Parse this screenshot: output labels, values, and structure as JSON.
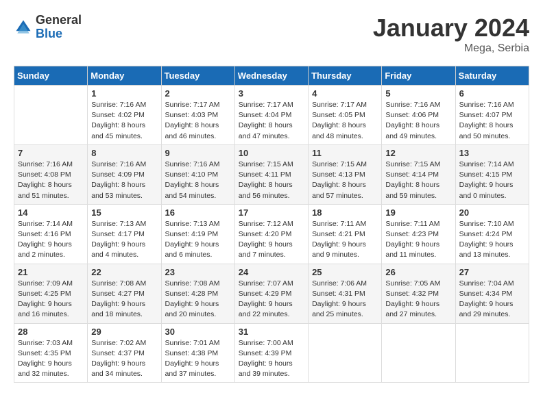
{
  "logo": {
    "general": "General",
    "blue": "Blue"
  },
  "title": "January 2024",
  "location": "Mega, Serbia",
  "days_of_week": [
    "Sunday",
    "Monday",
    "Tuesday",
    "Wednesday",
    "Thursday",
    "Friday",
    "Saturday"
  ],
  "weeks": [
    [
      {
        "day": "",
        "text": ""
      },
      {
        "day": "1",
        "text": "Sunrise: 7:16 AM\nSunset: 4:02 PM\nDaylight: 8 hours\nand 45 minutes."
      },
      {
        "day": "2",
        "text": "Sunrise: 7:17 AM\nSunset: 4:03 PM\nDaylight: 8 hours\nand 46 minutes."
      },
      {
        "day": "3",
        "text": "Sunrise: 7:17 AM\nSunset: 4:04 PM\nDaylight: 8 hours\nand 47 minutes."
      },
      {
        "day": "4",
        "text": "Sunrise: 7:17 AM\nSunset: 4:05 PM\nDaylight: 8 hours\nand 48 minutes."
      },
      {
        "day": "5",
        "text": "Sunrise: 7:16 AM\nSunset: 4:06 PM\nDaylight: 8 hours\nand 49 minutes."
      },
      {
        "day": "6",
        "text": "Sunrise: 7:16 AM\nSunset: 4:07 PM\nDaylight: 8 hours\nand 50 minutes."
      }
    ],
    [
      {
        "day": "7",
        "text": "Sunrise: 7:16 AM\nSunset: 4:08 PM\nDaylight: 8 hours\nand 51 minutes."
      },
      {
        "day": "8",
        "text": "Sunrise: 7:16 AM\nSunset: 4:09 PM\nDaylight: 8 hours\nand 53 minutes."
      },
      {
        "day": "9",
        "text": "Sunrise: 7:16 AM\nSunset: 4:10 PM\nDaylight: 8 hours\nand 54 minutes."
      },
      {
        "day": "10",
        "text": "Sunrise: 7:15 AM\nSunset: 4:11 PM\nDaylight: 8 hours\nand 56 minutes."
      },
      {
        "day": "11",
        "text": "Sunrise: 7:15 AM\nSunset: 4:13 PM\nDaylight: 8 hours\nand 57 minutes."
      },
      {
        "day": "12",
        "text": "Sunrise: 7:15 AM\nSunset: 4:14 PM\nDaylight: 8 hours\nand 59 minutes."
      },
      {
        "day": "13",
        "text": "Sunrise: 7:14 AM\nSunset: 4:15 PM\nDaylight: 9 hours\nand 0 minutes."
      }
    ],
    [
      {
        "day": "14",
        "text": "Sunrise: 7:14 AM\nSunset: 4:16 PM\nDaylight: 9 hours\nand 2 minutes."
      },
      {
        "day": "15",
        "text": "Sunrise: 7:13 AM\nSunset: 4:17 PM\nDaylight: 9 hours\nand 4 minutes."
      },
      {
        "day": "16",
        "text": "Sunrise: 7:13 AM\nSunset: 4:19 PM\nDaylight: 9 hours\nand 6 minutes."
      },
      {
        "day": "17",
        "text": "Sunrise: 7:12 AM\nSunset: 4:20 PM\nDaylight: 9 hours\nand 7 minutes."
      },
      {
        "day": "18",
        "text": "Sunrise: 7:11 AM\nSunset: 4:21 PM\nDaylight: 9 hours\nand 9 minutes."
      },
      {
        "day": "19",
        "text": "Sunrise: 7:11 AM\nSunset: 4:23 PM\nDaylight: 9 hours\nand 11 minutes."
      },
      {
        "day": "20",
        "text": "Sunrise: 7:10 AM\nSunset: 4:24 PM\nDaylight: 9 hours\nand 13 minutes."
      }
    ],
    [
      {
        "day": "21",
        "text": "Sunrise: 7:09 AM\nSunset: 4:25 PM\nDaylight: 9 hours\nand 16 minutes."
      },
      {
        "day": "22",
        "text": "Sunrise: 7:08 AM\nSunset: 4:27 PM\nDaylight: 9 hours\nand 18 minutes."
      },
      {
        "day": "23",
        "text": "Sunrise: 7:08 AM\nSunset: 4:28 PM\nDaylight: 9 hours\nand 20 minutes."
      },
      {
        "day": "24",
        "text": "Sunrise: 7:07 AM\nSunset: 4:29 PM\nDaylight: 9 hours\nand 22 minutes."
      },
      {
        "day": "25",
        "text": "Sunrise: 7:06 AM\nSunset: 4:31 PM\nDaylight: 9 hours\nand 25 minutes."
      },
      {
        "day": "26",
        "text": "Sunrise: 7:05 AM\nSunset: 4:32 PM\nDaylight: 9 hours\nand 27 minutes."
      },
      {
        "day": "27",
        "text": "Sunrise: 7:04 AM\nSunset: 4:34 PM\nDaylight: 9 hours\nand 29 minutes."
      }
    ],
    [
      {
        "day": "28",
        "text": "Sunrise: 7:03 AM\nSunset: 4:35 PM\nDaylight: 9 hours\nand 32 minutes."
      },
      {
        "day": "29",
        "text": "Sunrise: 7:02 AM\nSunset: 4:37 PM\nDaylight: 9 hours\nand 34 minutes."
      },
      {
        "day": "30",
        "text": "Sunrise: 7:01 AM\nSunset: 4:38 PM\nDaylight: 9 hours\nand 37 minutes."
      },
      {
        "day": "31",
        "text": "Sunrise: 7:00 AM\nSunset: 4:39 PM\nDaylight: 9 hours\nand 39 minutes."
      },
      {
        "day": "",
        "text": ""
      },
      {
        "day": "",
        "text": ""
      },
      {
        "day": "",
        "text": ""
      }
    ]
  ]
}
